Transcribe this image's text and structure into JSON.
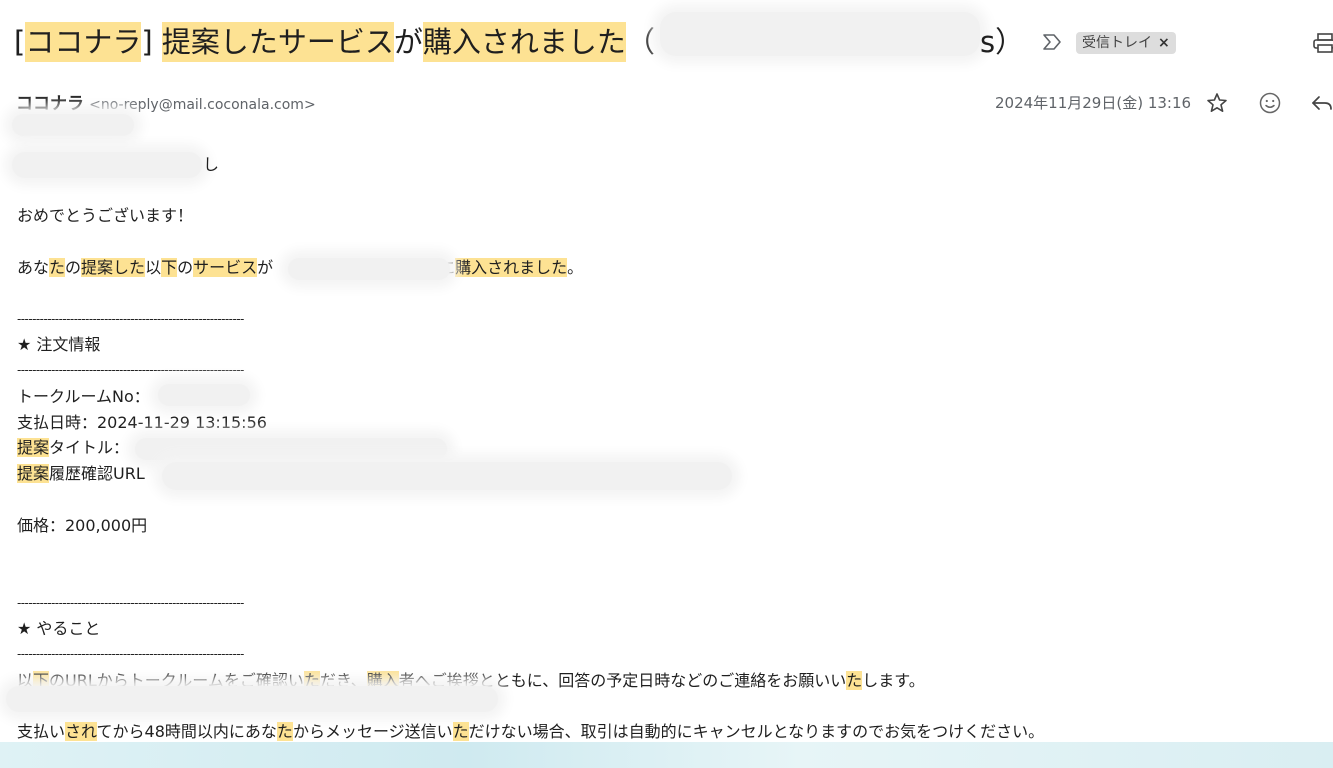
{
  "subject": {
    "bracket_open": "[",
    "brand": "ココナラ",
    "bracket_close": "] ",
    "part1": "提案したサービス",
    "part2": "が",
    "part3": "購入されました",
    "paren_open": "（",
    "tail": "s）"
  },
  "label": {
    "name": "受信トレイ",
    "close": "×"
  },
  "sender": {
    "name": "ココナラ",
    "email": "<no-reply@mail.coconala.com>"
  },
  "date": "2024年11月29日(金) 13:16",
  "icons": {
    "label_icon": "label-arrow-icon",
    "print_icon": "print-icon",
    "star_icon": "star-icon",
    "emoji_icon": "emoji-icon",
    "reply_icon": "reply-icon"
  },
  "body": {
    "greeting_tail": "し",
    "congrats": "おめでとうございます！",
    "purchase_line": {
      "a": "あな",
      "b": "た",
      "c": "の",
      "d": "提案した",
      "e": "以",
      "f": "下",
      "g": "の",
      "h": "サービス",
      "i": "が",
      "j": "に",
      "k": "購入されました",
      "l": "。"
    },
    "divider": "------------------------------------------------------------",
    "order_header": "★ 注文情報",
    "talkroom_label": "トークルームNo：",
    "paid_at": "支払日時：2024-11-29 13:15:56",
    "title_hl": "提案",
    "title_rest": "タイトル：",
    "history_hl": "提案",
    "history_rest": "履歴確認URL",
    "price": "価格：200,000円",
    "todo_header": "★ やること",
    "todo_line": {
      "a": "以",
      "b": "下",
      "c": "のURLからトークルームをご確認い",
      "d": "た",
      "e": "だき、",
      "f": "購入",
      "g": "者へご挨拶とともに、回答の予定日時などのご連絡をお願いい",
      "h": "た",
      "i": "します。"
    },
    "warn_line": {
      "a": "支払い",
      "b": "され",
      "c": "てから48時間以内にあな",
      "d": "た",
      "e": "からメッセージ送信い",
      "f": "た",
      "g": "だけない場合、取引は自動的にキャンセルとなりますのでお気をつけください。"
    }
  },
  "colors": {
    "highlight": "#fde293",
    "chip_bg": "#dddddd",
    "muted": "#5f6368"
  }
}
